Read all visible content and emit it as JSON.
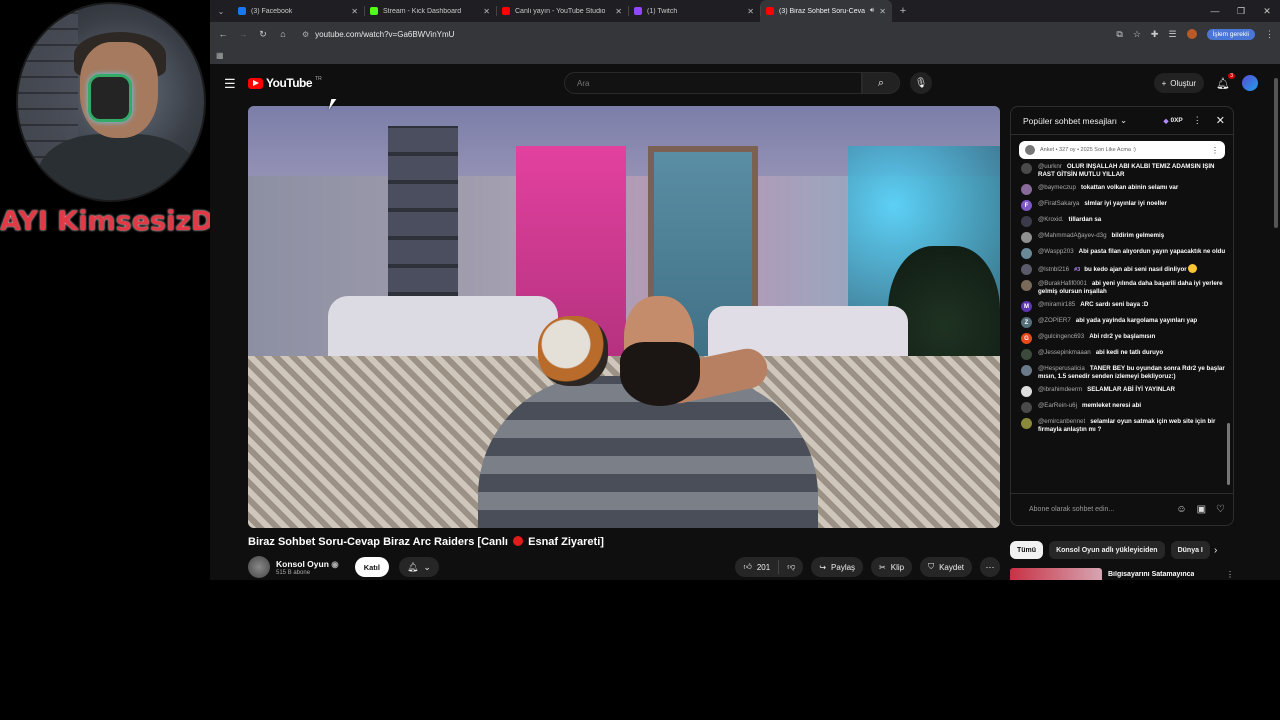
{
  "webcam": {
    "overlay_text": "AYI KimsesizD"
  },
  "browser": {
    "tabs": [
      {
        "label": "(3) Facebook",
        "favicon_color": "#1877f2",
        "active": false
      },
      {
        "label": "Stream - Kick Dashboard",
        "favicon_color": "#53fc18",
        "active": false
      },
      {
        "label": "Canlı yayın - YouTube Studio",
        "favicon_color": "#ff0000",
        "active": false
      },
      {
        "label": "(1) Twitch",
        "favicon_color": "#9146ff",
        "active": false
      },
      {
        "label": "(3) Biraz Sohbet Soru-Cevap",
        "favicon_color": "#ff0000",
        "active": true
      }
    ],
    "url": "youtube.com/watch?v=Ga6BWVinYmU",
    "profile_chip": "İşlem gerekli"
  },
  "youtube": {
    "logo_word": "YouTube",
    "logo_country": "TR",
    "search_placeholder": "Ara",
    "create_label": "Oluştur",
    "notifications_count": "3",
    "video_title": "Biraz Sohbet Soru-Cevap Biraz Arc Raiders [Canlı",
    "video_title_end": "Esnaf Ziyareti]",
    "channel_name": "Konsol Oyun",
    "subscribers": "515 B abone",
    "join_label": "Katıl",
    "likes": "201",
    "share_label": "Paylaş",
    "clip_label": "Klip",
    "save_label": "Kaydet"
  },
  "chat": {
    "header_title": "Popüler sohbet mesajları",
    "xp_label": "0XP",
    "pinned": "Anket • 327 oy • 2025 Son Like Acma :)",
    "messages": [
      {
        "author": "@uurknr",
        "text": "OLUR İNŞALLAH ABİ KALBİ TEMİZ ADAMSIN İŞİN RAST GİTSİN MUTLU YILLAR",
        "avatar_color": "#4a4a4a",
        "initial": ""
      },
      {
        "author": "@baymeczup",
        "text": "tokattan volkan abinin selamı var",
        "avatar_color": "#8a6a9a",
        "initial": ""
      },
      {
        "author": "@FiratSakarya",
        "text": "slmlar iyi yayınlar iyi noeller",
        "avatar_color": "#7e57c2",
        "initial": "F"
      },
      {
        "author": "@Kroxid.",
        "text": "tillardan sa",
        "avatar_color": "#3a3a4a",
        "initial": ""
      },
      {
        "author": "@MahmmadAğayev-d3g",
        "text": "bildirim gelmemiş",
        "avatar_color": "#909090",
        "initial": ""
      },
      {
        "author": "@Waspp203",
        "text": "Abi pasta filan alıyordun yayın yapacaktık ne oldu",
        "avatar_color": "#6a8a9a",
        "initial": ""
      },
      {
        "author": "@lstnbl216",
        "badge": "#3",
        "text": "bu kedo ajan abi seni nasıl dinliyor",
        "avatar_color": "#5a5a6a",
        "initial": "",
        "emoji": true
      },
      {
        "author": "@BurakHafif0001",
        "text": "abi yeni yılında daha başarili daha iyi yerlere gelmiş olursun inşallah",
        "avatar_color": "#7a6a5a",
        "initial": ""
      },
      {
        "author": "@miramir185",
        "text": "ARC sardı seni baya :D",
        "avatar_color": "#5e35b1",
        "initial": "M"
      },
      {
        "author": "@ZOPİER7",
        "text": "abi yada yayinda kargolama yayınları yap",
        "avatar_color": "#546e7a",
        "initial": "Z"
      },
      {
        "author": "@gulcingenc693",
        "text": "Abi rdr2 ye başlamısın",
        "avatar_color": "#e64a19",
        "initial": "G"
      },
      {
        "author": "@Jessepinkmaaan",
        "text": "abi kedi ne tatlı duruyo",
        "avatar_color": "#3c4a3c",
        "initial": ""
      },
      {
        "author": "@Hesperusalicia",
        "text": "TANER BEY bu oyundan sonra Rdr2 ye başlar mısın, 1.5 senedir senden izlemeyi bekliyoruz:)",
        "avatar_color": "#6a7a8a",
        "initial": ""
      },
      {
        "author": "@ibrahimdeerm",
        "text": "SELAMLAR ABİ İYİ YAYINLAR",
        "avatar_color": "#dddddd",
        "initial": ""
      },
      {
        "author": "@EarRein-u6j",
        "text": "memleket neresi abi",
        "avatar_color": "#4a4a4a",
        "initial": ""
      },
      {
        "author": "@emircanbennet",
        "text": "selamlar oyun satmak için web site için bir firmayla anlaştın mı ?",
        "avatar_color": "#8a8a3a",
        "initial": ""
      }
    ],
    "input_placeholder": "Abone olarak sohbet edin..."
  },
  "chips": [
    {
      "label": "Tümü",
      "active": true
    },
    {
      "label": "Konsol Oyun adlı yükleyiciden",
      "active": false
    },
    {
      "label": "Dünya I",
      "active": false
    }
  ],
  "recommendation": {
    "title": "Bilgisayarını Satamayınca"
  }
}
